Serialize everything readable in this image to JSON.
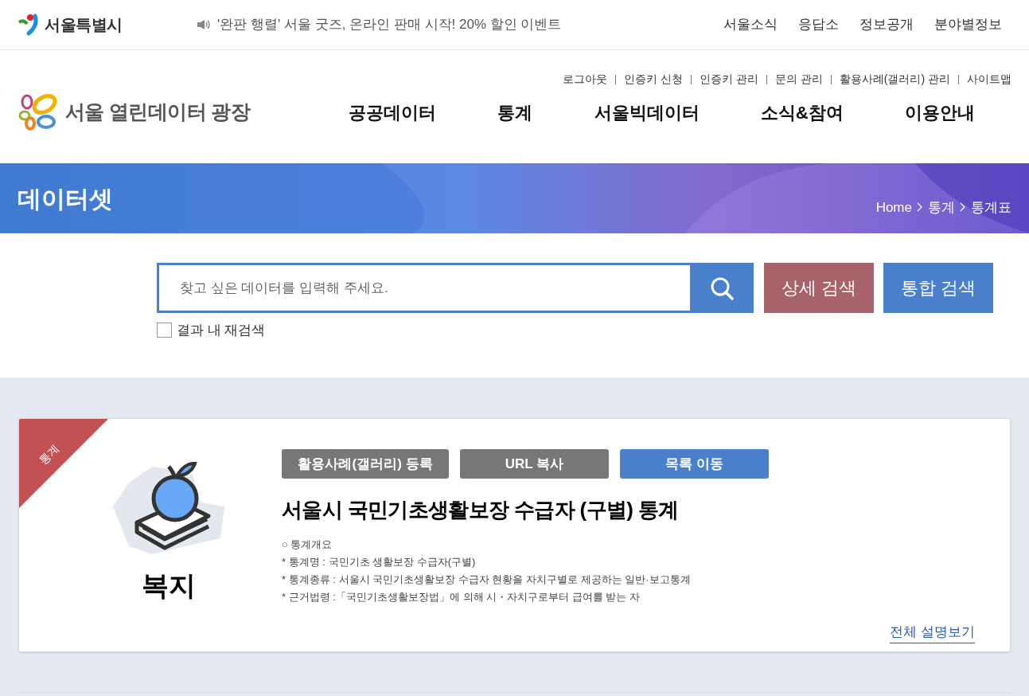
{
  "gov_logo": {
    "text": "서울특별시"
  },
  "notice": {
    "text": "'완판 행렬' 서울 굿즈, 온라인 판매 시작! 20% 할인 이벤트"
  },
  "top_links": [
    "서울소식",
    "응답소",
    "정보공개",
    "분야별정보"
  ],
  "util_links": [
    "로그아웃",
    "인증키 신청",
    "인증키 관리",
    "문의 관리",
    "활용사례(갤러리) 관리",
    "사이트맵"
  ],
  "site_logo": {
    "text": "서울 열린데이터 광장"
  },
  "main_nav": [
    "공공데이터",
    "통계",
    "서울빅데이터",
    "소식&참여",
    "이용안내"
  ],
  "banner": {
    "title": "데이터셋",
    "breadcrumb": [
      "Home",
      "통계",
      "통계표"
    ]
  },
  "search": {
    "placeholder": "찾고 싶은 데이터를 입력해 주세요.",
    "buttons": [
      "상세 검색",
      "통합 검색"
    ],
    "recheck": {
      "label": "결과 내 재검색",
      "checked": false
    }
  },
  "dataset": {
    "ribbon": "통계",
    "category": "복지",
    "actions": [
      {
        "label": "활용사례(갤러리) 등록",
        "kind": "gray"
      },
      {
        "label": "URL 복사",
        "kind": "gray"
      },
      {
        "label": "목록 이동",
        "kind": "blue"
      }
    ],
    "title": "서울시 국민기초생활보장 수급자 (구별) 통계",
    "description": [
      "○ 통계개요",
      "* 통계명 : 국민기초 생활보장 수급자(구별)",
      "* 통계종류 : 서울시 국민기초생활보장 수급자 현황을 자치구별로 제공하는 일반·보고통계",
      "* 근거법령 :「국민기초생활보장법」에 의해 시・자치구로부터 급여를 받는 자"
    ],
    "more_link": "전체 설명보기"
  }
}
